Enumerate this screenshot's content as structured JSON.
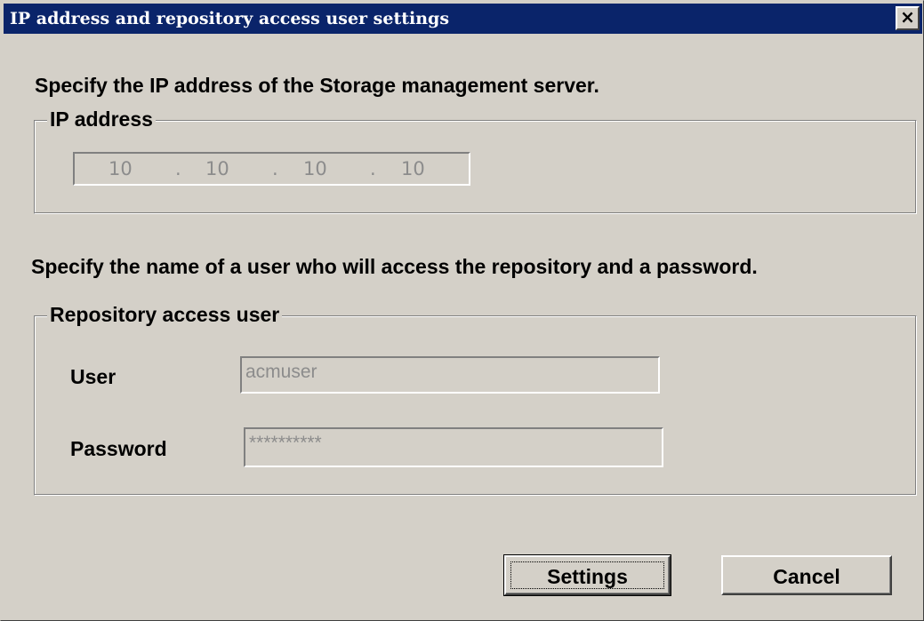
{
  "window": {
    "title": "IP address and repository access user settings",
    "close_label": "×"
  },
  "ip_section": {
    "instruction": "Specify the IP address of the Storage management server.",
    "group_label": "IP address",
    "octets": [
      "10",
      "10",
      "10",
      "10"
    ],
    "separator": "."
  },
  "user_section": {
    "instruction": "Specify the name of a user who will access the repository and a password.",
    "group_label": "Repository access user",
    "user_label": "User",
    "user_value": "acmuser",
    "password_label": "Password",
    "password_value": "**********"
  },
  "buttons": {
    "settings_label": "Settings",
    "cancel_label": "Cancel"
  },
  "colors": {
    "titlebar": "#0a246a",
    "face": "#d4d0c8",
    "disabled_text": "#8c8c8c"
  }
}
